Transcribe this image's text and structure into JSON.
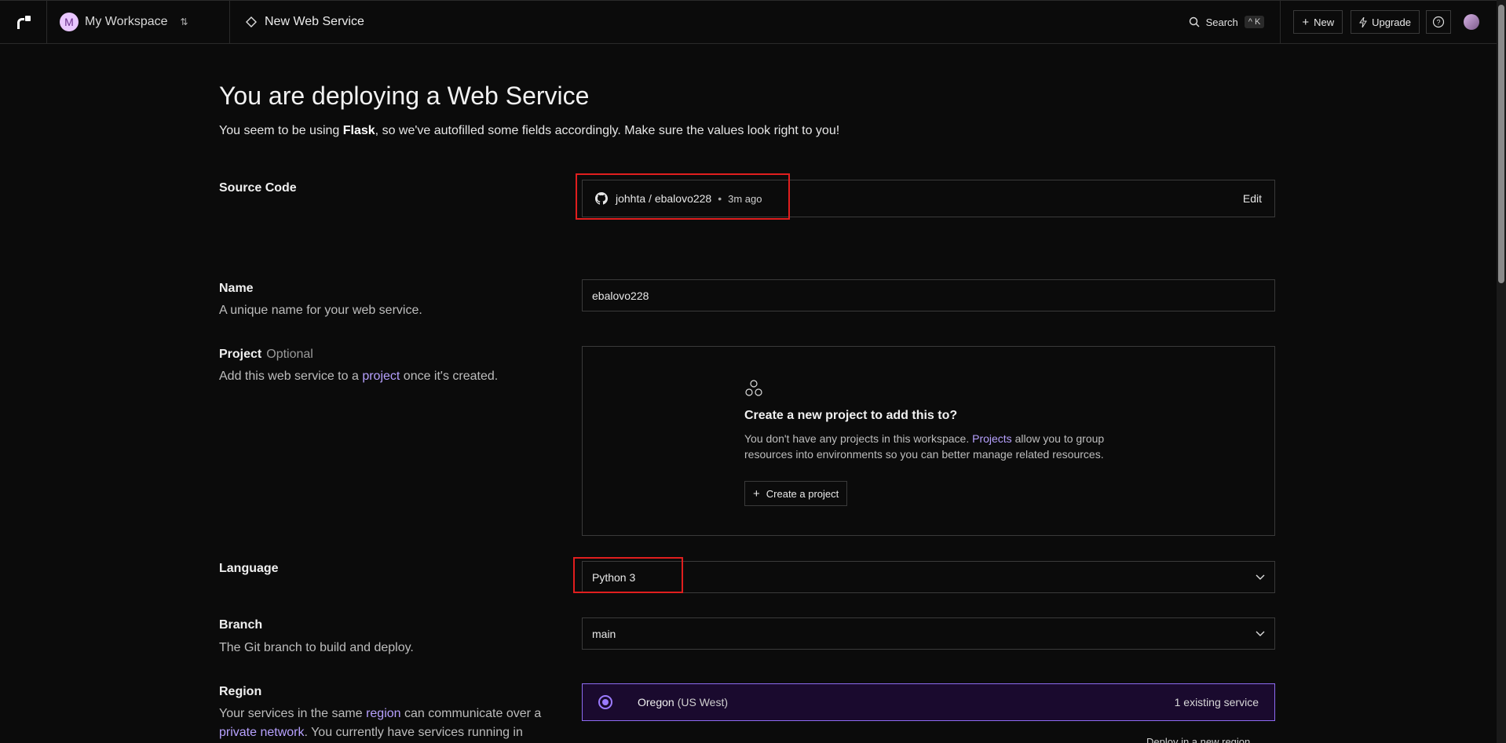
{
  "header": {
    "workspace_initial": "M",
    "workspace_name": "My Workspace",
    "breadcrumb": "New Web Service",
    "search_label": "Search",
    "search_shortcut": "^ K",
    "new_label": "New",
    "upgrade_label": "Upgrade"
  },
  "page": {
    "title": "You are deploying a Web Service",
    "subtitle_pre": "You seem to be using ",
    "subtitle_bold": "Flask",
    "subtitle_post": ", so we've autofilled some fields accordingly. Make sure the values look right to you!"
  },
  "source": {
    "label": "Source Code",
    "repo": "johhta / ebalovo228",
    "dot": "•",
    "time": "3m ago",
    "edit_label": "Edit"
  },
  "name": {
    "label": "Name",
    "desc": "A unique name for your web service.",
    "value": "ebalovo228"
  },
  "project": {
    "label": "Project",
    "optional": "Optional",
    "desc_pre": "Add this web service to a ",
    "desc_link": "project",
    "desc_post": " once it's created.",
    "box_title": "Create a new project to add this to?",
    "box_desc_pre": "You don't have any projects in this workspace. ",
    "box_desc_link": "Projects",
    "box_desc_post": " allow you to group resources into environments so you can better manage related resources.",
    "create_label": "Create a project"
  },
  "language": {
    "label": "Language",
    "value": "Python 3"
  },
  "branch": {
    "label": "Branch",
    "desc": "The Git branch to build and deploy.",
    "value": "main"
  },
  "region": {
    "label": "Region",
    "desc_pre": "Your services in the same ",
    "desc_link1": "region",
    "desc_mid": " can communicate over a ",
    "desc_link2": "private network",
    "desc_post": ". You currently have services running in",
    "selected_name": "Oregon",
    "selected_sub": "(US West)",
    "selected_count": "1 existing service",
    "deploy_new": "Deploy in a new region"
  },
  "colors": {
    "accent": "#9c7bff",
    "highlight": "#e01e1e",
    "background": "#0b0b0b"
  }
}
